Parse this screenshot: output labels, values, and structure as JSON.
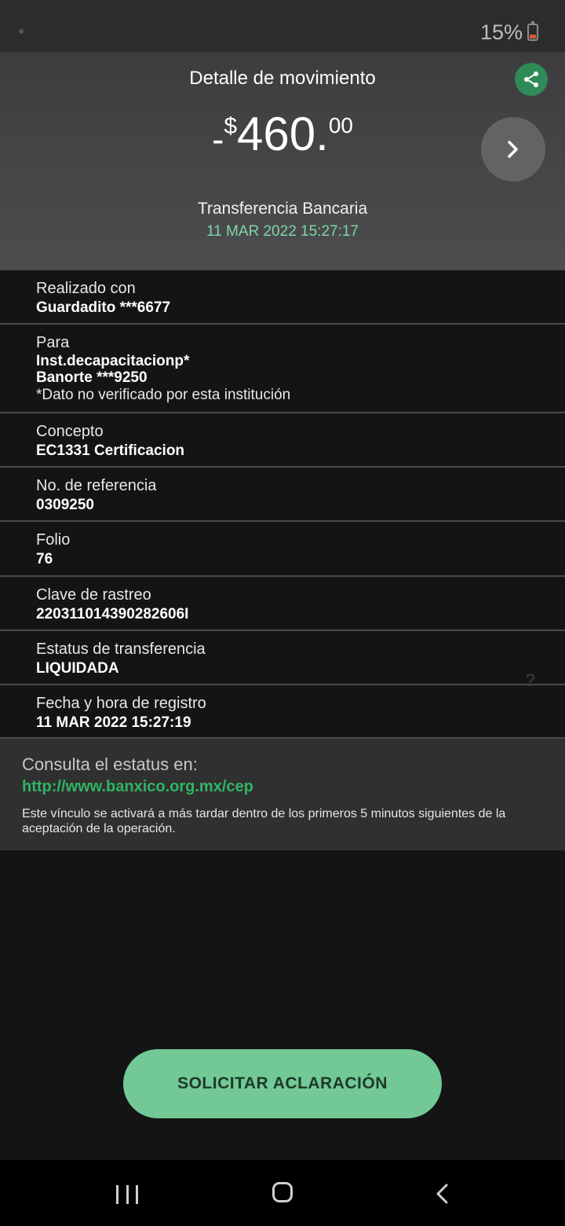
{
  "status_bar": {
    "battery": "15%"
  },
  "header": {
    "title": "Detalle de movimiento",
    "amount": {
      "sign": "-",
      "currency": "$",
      "integer": "460",
      "separator": ".",
      "cents": "00"
    },
    "type": "Transferencia Bancaria",
    "datetime": "11 MAR 2022 15:27:17"
  },
  "rows": {
    "realizado": {
      "label": "Realizado con",
      "value": "Guardadito ***6677"
    },
    "para": {
      "label": "Para",
      "value_1": "Inst.decapacitacionp*",
      "value_2": "Banorte ***9250",
      "note": "*Dato no verificado por esta institución"
    },
    "concepto": {
      "label": "Concepto",
      "value": "EC1331 Certificacion"
    },
    "referencia": {
      "label": "No. de referencia",
      "value": "0309250"
    },
    "folio": {
      "label": "Folio",
      "value": "76"
    },
    "rastreo": {
      "label": "Clave de rastreo",
      "value": "220311014390282606I"
    },
    "estatus": {
      "label": "Estatus de transferencia",
      "value": "LIQUIDADA",
      "help": "?"
    },
    "fecha": {
      "label": "Fecha y hora de registro",
      "value": "11 MAR 2022 15:27:19"
    }
  },
  "info": {
    "title": "Consulta el estatus en:",
    "link": "http://www.banxico.org.mx/cep",
    "text": "Este vínculo se activará a más tardar dentro de los primeros 5 minutos siguientes de la aceptación de la operación."
  },
  "cta": {
    "label": "SOLICITAR ACLARACIÓN"
  },
  "colors": {
    "accent": "#72c995",
    "link": "#2fb562",
    "share": "#2e8b57",
    "date": "#7fd6a5"
  },
  "icons": {
    "share": "share-icon",
    "next": "chevron-right-icon",
    "recents": "recents-icon",
    "home": "home-icon",
    "back": "back-icon"
  }
}
